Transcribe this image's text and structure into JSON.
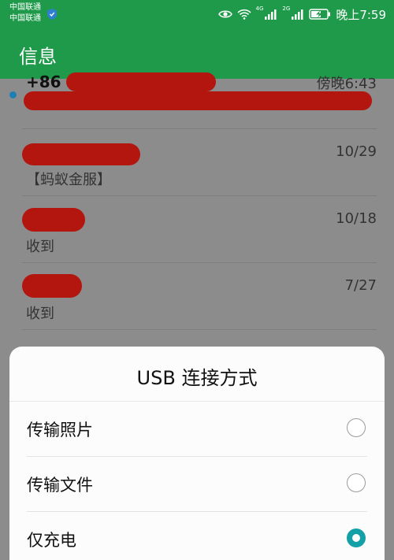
{
  "status_bar": {
    "carrier_1": "中国联通",
    "carrier_2": "中国联通",
    "network_1": "4G",
    "network_2": "2G",
    "time": "晚上7:59"
  },
  "app_bar": {
    "title": "信息"
  },
  "messages": [
    {
      "sender": "+86 1",
      "date": "傍晚6:43",
      "snippet": "",
      "unread": true
    },
    {
      "sender": "",
      "date": "10/29",
      "snippet": "【蚂蚁金服】",
      "unread": false
    },
    {
      "sender": "",
      "date": "10/18",
      "snippet": "收到",
      "unread": false
    },
    {
      "sender": "",
      "date": "7/27",
      "snippet": "收到",
      "unread": false
    }
  ],
  "usb_dialog": {
    "title": "USB 连接方式",
    "options": [
      {
        "label": "传输照片",
        "selected": false
      },
      {
        "label": "传输文件",
        "selected": false
      },
      {
        "label": "仅充电",
        "selected": true
      }
    ]
  },
  "colors": {
    "brand_green": "#1f9a4a",
    "radio_accent": "#13a0a6",
    "redaction": "#b3160f",
    "unread_dot": "#1e7fb4"
  }
}
